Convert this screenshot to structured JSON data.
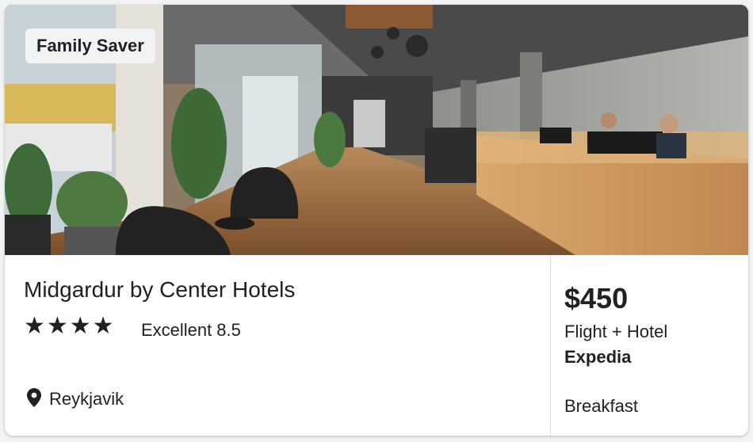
{
  "card": {
    "badge": "Family Saver",
    "hotel_name": "Midgardur by Center Hotels",
    "stars": "★★★★",
    "star_count": 4,
    "rating_label": "Excellent",
    "rating_score": "8.5",
    "location": "Reykjavik",
    "price": "$450",
    "package": "Flight + Hotel",
    "provider": "Expedia",
    "amenity": "Breakfast"
  },
  "icons": {
    "location": "map-pin-icon",
    "star": "star-icon"
  },
  "colors": {
    "text": "#202124",
    "badge_bg": "#f1f3f4",
    "divider": "#dadce0"
  }
}
